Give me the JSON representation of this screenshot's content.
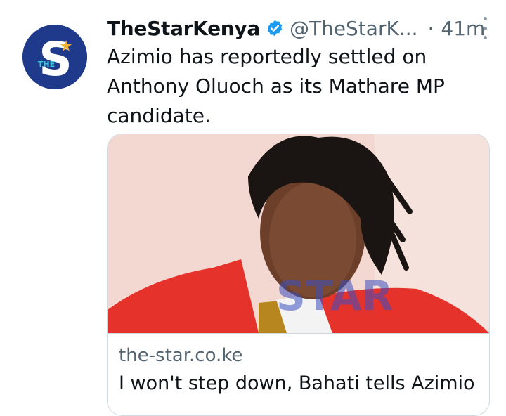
{
  "tweet": {
    "display_name": "TheStarKenya",
    "handle": "@TheStarK...",
    "separator": "·",
    "time": "41m",
    "text": "Azimio has reportedly settled on Anthony Oluoch as its Mathare MP candidate."
  },
  "avatar": {
    "logo_letter": "S",
    "logo_small_text": "THE"
  },
  "card": {
    "watermark": "STAR",
    "domain": "the-star.co.ke",
    "title": "I won't step down, Bahati tells Azimio"
  },
  "colors": {
    "avatar_bg": "#1f3a8a",
    "verified": "#1d9bf0",
    "secondary_text": "#536471",
    "jacket_red": "#e5322b",
    "image_bg": "#f3d7d1"
  }
}
